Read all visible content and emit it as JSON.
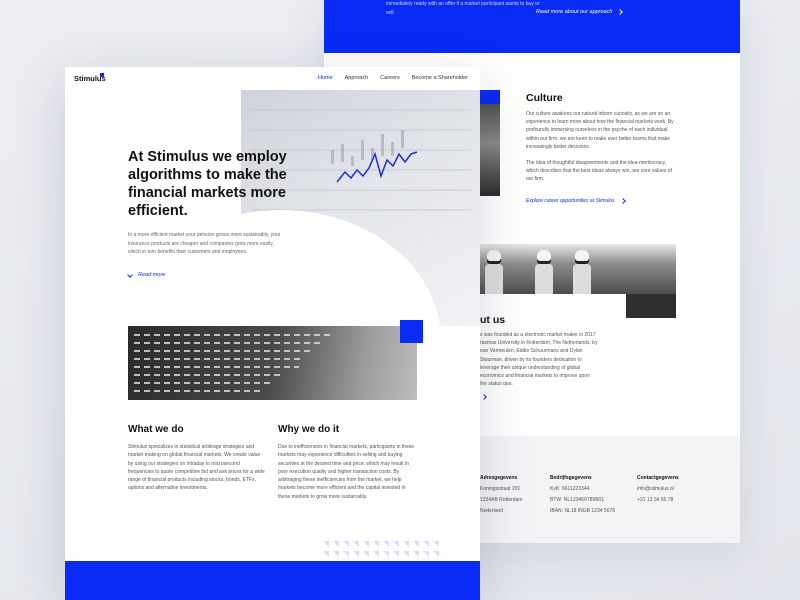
{
  "back_page": {
    "banner": {
      "text": "immediately ready with an offer if a market participant wants to buy or sell.",
      "link_label": "Read more about our approach"
    },
    "culture": {
      "title": "Culture",
      "paragraph_1": "Our culture awakens our natural inborn curiosity, as we are on an experience to learn more about how the financial markets work. By profoundly immersing ourselves in the psyche of each individual within our firm, we are keen to make ever better teams that make increasingly better decisions.",
      "paragraph_2": "The idea of thoughtful disagreements and the idea-meritocracy, which describes that the best ideas always win, are core values of our firm.",
      "link_label": "Explore career opportunities at Stimulus"
    },
    "about": {
      "title": "ut us",
      "body": "s was founded as a electronic market maker in 2017 rasmus University in Rotterdam, The Netherlands, by ean Vermeulen, Eddie Schuurmans and Dylan Stuurman, driven by its founders dedication to leverage their unique understanding of global economics and financial markets to improve upon the status quo."
    },
    "footer": {
      "col1": {
        "heading": "Adresgegevens",
        "line1": "Koningsstraat 201",
        "line2": "1234AB Rotterdam",
        "line3": "Nederland"
      },
      "col2": {
        "heading": "Bedrijfsgegevens",
        "line1": "KvK: 6611223344",
        "line2": "BTW: NL123456789B01",
        "line3": "IBAN: NL18 INGB 1234 5678"
      },
      "col3": {
        "heading": "Contactgegevens",
        "line1": "info@stimulus.nl",
        "line2": "+31 12 34 56 78"
      }
    }
  },
  "front_page": {
    "logo": "Stimulus",
    "nav": {
      "home": "Home",
      "approach": "Approach",
      "careers": "Careers",
      "shareholder": "Become a Shareholder"
    },
    "hero": {
      "title": "At Stimulus we employ algorithms to make the financial markets more efficient.",
      "body": "In a more efficient market your pension grows more sustainably, your insurance products are cheaper and companies grow more easily, which in turn benefits their customers and employees.",
      "read_more": "Read more"
    },
    "what_we_do": {
      "title": "What we do",
      "body": "Stimulus specializes in statistical arbitrage strategies and market making on global financial markets. We create value by using our strategies on intraday to microsecond frequencies to quote competitive bid and ask prices for a wide range of financial products including stocks, bonds, ETFs, options and alternative investments."
    },
    "why_we_do_it": {
      "title": "Why we do it",
      "body": "Due to inefficiencies in financial markets, participants in these markets may experience difficulties in selling and buying securities at the desired time and price, which may result in poor execution quality and higher transaction costs. By arbitraging these inefficiencies from the market, we help markets become more efficient and the capital invested in these markets to grow more sustainably."
    }
  },
  "colors": {
    "brand_blue": "#0a2bf5",
    "background": "#e6e8ee",
    "footer_grey": "#f3f4f6"
  }
}
